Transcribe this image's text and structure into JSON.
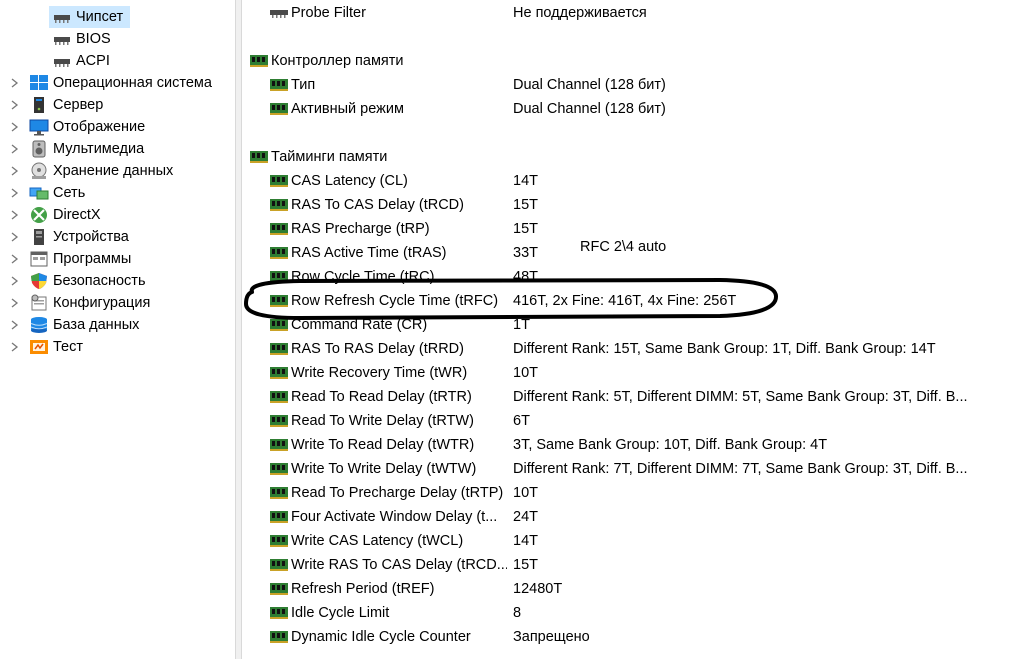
{
  "tree": {
    "items": [
      {
        "label": "Чипсет",
        "icon": "chipset-icon",
        "selected": true
      },
      {
        "label": "BIOS",
        "icon": "bios-chip-icon"
      },
      {
        "label": "ACPI",
        "icon": "acpi-chip-icon"
      },
      {
        "label": "Операционная система",
        "icon": "windows-logo-icon"
      },
      {
        "label": "Сервер",
        "icon": "server-icon"
      },
      {
        "label": "Отображение",
        "icon": "monitor-icon"
      },
      {
        "label": "Мультимедиа",
        "icon": "speaker-icon"
      },
      {
        "label": "Хранение данных",
        "icon": "disk-icon"
      },
      {
        "label": "Сеть",
        "icon": "network-icon"
      },
      {
        "label": "DirectX",
        "icon": "xbox-icon"
      },
      {
        "label": "Устройства",
        "icon": "devices-icon"
      },
      {
        "label": "Программы",
        "icon": "programs-icon"
      },
      {
        "label": "Безопасность",
        "icon": "shield-icon"
      },
      {
        "label": "Конфигурация",
        "icon": "configuration-icon"
      },
      {
        "label": "База данных",
        "icon": "database-icon"
      },
      {
        "label": "Тест",
        "icon": "test-icon"
      }
    ]
  },
  "details": {
    "rows": [
      {
        "name": "Probe Filter",
        "value": "Не поддерживается"
      },
      {
        "name": "Контроллер памяти",
        "value": ""
      },
      {
        "name": "Тип",
        "value": "Dual Channel  (128 бит)"
      },
      {
        "name": "Активный режим",
        "value": "Dual Channel  (128 бит)"
      },
      {
        "name": "Тайминги памяти",
        "value": ""
      },
      {
        "name": "CAS Latency (CL)",
        "value": "14T"
      },
      {
        "name": "RAS To CAS Delay (tRCD)",
        "value": "15T"
      },
      {
        "name": "RAS Precharge (tRP)",
        "value": "15T"
      },
      {
        "name": "RAS Active Time (tRAS)",
        "value": "33T"
      },
      {
        "name": "Row Cycle Time (tRC)",
        "value": "48T"
      },
      {
        "name": "Row Refresh Cycle Time (tRFC)",
        "value": "416T, 2x Fine: 416T, 4x Fine: 256T"
      },
      {
        "name": "Command Rate (CR)",
        "value": "1T"
      },
      {
        "name": "RAS To RAS Delay (tRRD)",
        "value": "Different Rank: 15T, Same Bank Group: 1T, Diff. Bank Group: 14T"
      },
      {
        "name": "Write Recovery Time (tWR)",
        "value": "10T"
      },
      {
        "name": "Read To Read Delay (tRTR)",
        "value": "Different Rank: 5T, Different DIMM: 5T, Same Bank Group: 3T, Diff. B..."
      },
      {
        "name": "Read To Write Delay (tRTW)",
        "value": "6T"
      },
      {
        "name": "Write To Read Delay (tWTR)",
        "value": "3T, Same Bank Group: 10T, Diff. Bank Group: 4T"
      },
      {
        "name": "Write To Write Delay (tWTW)",
        "value": "Different Rank: 7T, Different DIMM: 7T, Same Bank Group: 3T, Diff. B..."
      },
      {
        "name": "Read To Precharge Delay (tRTP)",
        "value": "10T"
      },
      {
        "name": "Four Activate Window Delay (t...",
        "value": "24T"
      },
      {
        "name": "Write CAS Latency (tWCL)",
        "value": "14T"
      },
      {
        "name": "Write RAS To CAS Delay (tRCD...",
        "value": "15T"
      },
      {
        "name": "Refresh Period (tREF)",
        "value": "12480T"
      },
      {
        "name": "Idle Cycle Limit",
        "value": "8"
      },
      {
        "name": "Dynamic Idle Cycle Counter",
        "value": "Запрещено"
      }
    ]
  },
  "annotation": {
    "note": "RFC 2\\4 auto"
  },
  "colors": {
    "selection": "#cce8ff",
    "chip_green": "#2e7d32",
    "annotation_stroke": "#000000"
  }
}
